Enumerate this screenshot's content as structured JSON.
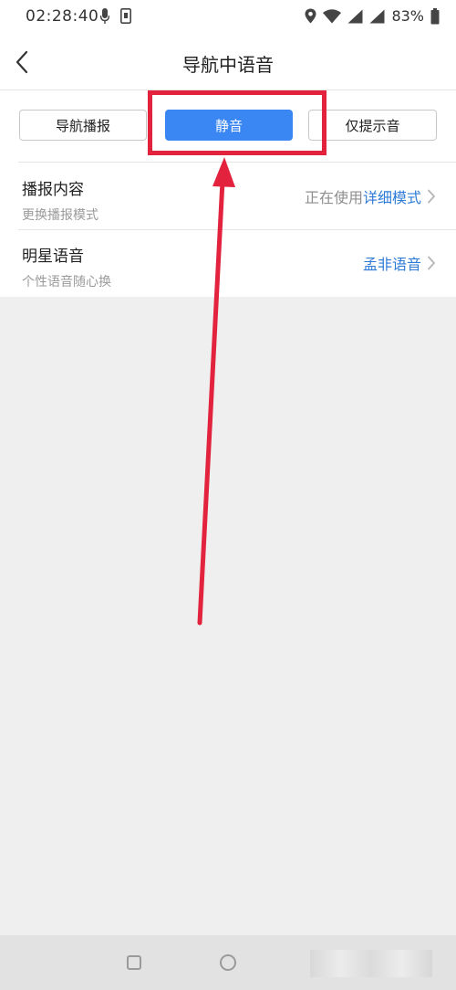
{
  "status_bar": {
    "time": "02:28:40",
    "battery": "83%",
    "icons": [
      "mic-icon",
      "sim-icon",
      "location-icon",
      "wifi-icon",
      "signal-icon",
      "signal-icon",
      "battery-icon"
    ]
  },
  "header": {
    "title": "导航中语音",
    "back_icon": "chevron-left-icon"
  },
  "voice_modes": [
    {
      "label": "导航播报",
      "active": false
    },
    {
      "label": "静音",
      "active": true
    },
    {
      "label": "仅提示音",
      "active": false
    }
  ],
  "settings": [
    {
      "title": "播报内容",
      "subtitle": "更换播报模式",
      "value_prefix": "正在使用",
      "value": "详细模式"
    },
    {
      "title": "明星语音",
      "subtitle": "个性语音随心换",
      "value_prefix": "",
      "value": "孟非语音"
    }
  ],
  "colors": {
    "accent": "#3a86f2",
    "link": "#2f7bd8",
    "annotation": "#e3223e",
    "background": "#efefef"
  },
  "bottom_nav": {
    "icons": [
      "recent-apps-icon",
      "home-icon",
      "back-icon"
    ]
  }
}
